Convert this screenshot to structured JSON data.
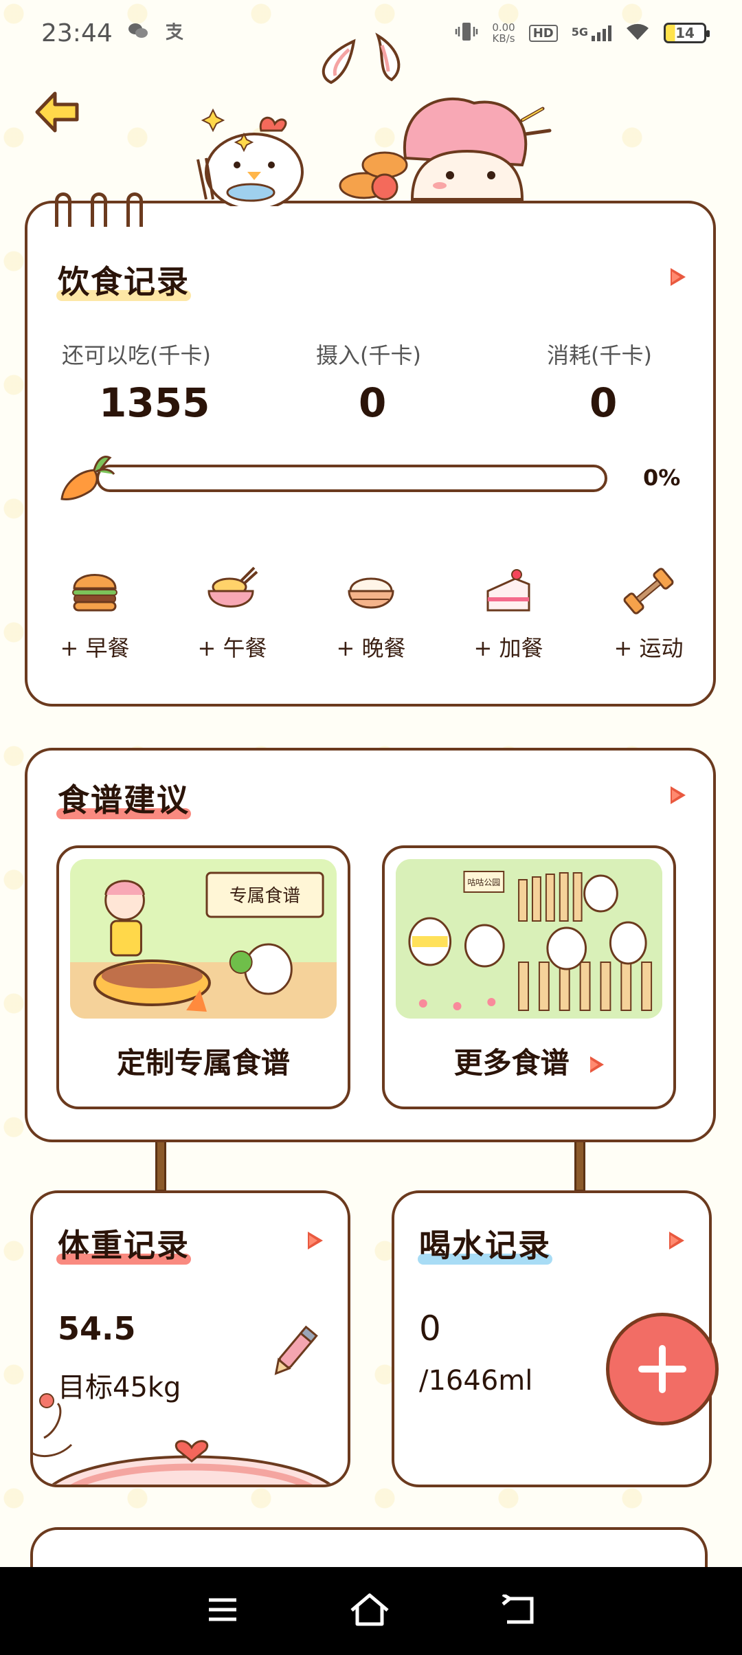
{
  "status_bar": {
    "time": "23:44",
    "speed_value": "0.00",
    "speed_unit": "KB/s",
    "hd_badge": "HD",
    "network": "5G",
    "battery": "14"
  },
  "diet": {
    "title": "饮食记录",
    "remaining_label": "还可以吃(千卡)",
    "remaining_value": "1355",
    "intake_label": "摄入(千卡)",
    "intake_value": "0",
    "burned_label": "消耗(千卡)",
    "burned_value": "0",
    "progress": 0,
    "progress_text": "0%",
    "meals": [
      {
        "label": "+ 早餐",
        "icon": "burger-icon"
      },
      {
        "label": "+ 午餐",
        "icon": "noodle-bowl-icon"
      },
      {
        "label": "+ 晚餐",
        "icon": "rice-bowl-icon"
      },
      {
        "label": "+ 加餐",
        "icon": "cake-icon"
      },
      {
        "label": "+ 运动",
        "icon": "dumbbell-icon"
      }
    ]
  },
  "recipes": {
    "title": "食谱建议",
    "custom_label": "定制专属食谱",
    "custom_sign": "专属食谱",
    "more_label": "更多食谱",
    "more_sign": "咕咕公园"
  },
  "weight": {
    "title": "体重记录",
    "value": "54.5",
    "target": "目标45kg"
  },
  "water": {
    "title": "喝水记录",
    "value": "0",
    "goal": "/1646ml"
  },
  "colors": {
    "brand_brown": "#6b3a1e",
    "accent_red": "#e9593f",
    "fab_red": "#f26d65",
    "highlight_yellow": "#fde7a6",
    "highlight_pink": "#f98a80",
    "highlight_blue": "#a8dcf5"
  }
}
